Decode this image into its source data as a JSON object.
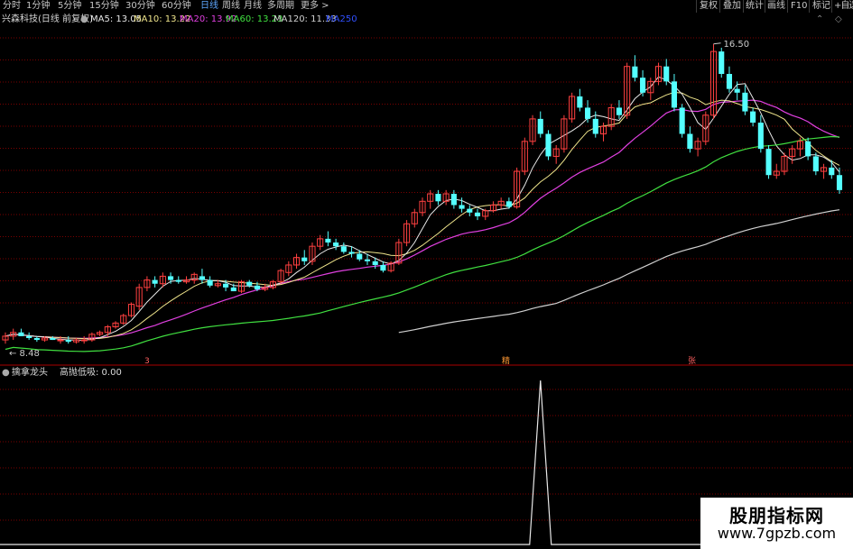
{
  "toolbar": {
    "periods": [
      "分时",
      "1分钟",
      "5分钟",
      "15分钟",
      "30分钟",
      "60分钟",
      "日线",
      "周线",
      "月线",
      "多周期",
      "更多 >"
    ],
    "active_period": "日线",
    "right_buttons": [
      "复权",
      "叠加",
      "统计",
      "画线",
      "F10",
      "标记",
      "+自选"
    ]
  },
  "info": {
    "title": "兴森科技(日线 前复权)",
    "ma": [
      {
        "label": "MA5: 13.05",
        "color": "#e8e8e8"
      },
      {
        "label": "MA10: 13.22",
        "color": "#f0e68c"
      },
      {
        "label": "MA20: 13.92",
        "color": "#e040e0"
      },
      {
        "label": "MA60: 13.23",
        "color": "#40e040"
      },
      {
        "label": "MA120: 11.33",
        "color": "#d0d0d0"
      },
      {
        "label": "MA250",
        "color": "#3050ff"
      }
    ]
  },
  "indicator": {
    "name": "擒拿龙头",
    "value_label": "高抛低吸: 0.00"
  },
  "annotations": {
    "high": "16.50",
    "low": "8.48",
    "marks": [
      "3",
      "精",
      "张"
    ]
  },
  "colors": {
    "up": "#ff4040",
    "down": "#54ffff",
    "grid": "#7a0000"
  },
  "watermark": {
    "line1": "股朋指标网",
    "line2": "www.7gpzb.com"
  },
  "chart_data": [
    {
      "type": "candlestick",
      "title": "兴森科技(日线 前复权)",
      "ylim": [
        8.0,
        17.0
      ],
      "candles": [
        [
          8.6,
          8.8,
          8.5,
          8.7
        ],
        [
          8.7,
          8.9,
          8.6,
          8.8
        ],
        [
          8.8,
          8.9,
          8.7,
          8.7
        ],
        [
          8.7,
          8.8,
          8.6,
          8.65
        ],
        [
          8.65,
          8.7,
          8.55,
          8.6
        ],
        [
          8.6,
          8.7,
          8.55,
          8.65
        ],
        [
          8.65,
          8.7,
          8.6,
          8.6
        ],
        [
          8.6,
          8.7,
          8.5,
          8.6
        ],
        [
          8.6,
          8.7,
          8.5,
          8.55
        ],
        [
          8.55,
          8.65,
          8.5,
          8.6
        ],
        [
          8.6,
          8.7,
          8.5,
          8.6
        ],
        [
          8.6,
          8.8,
          8.55,
          8.75
        ],
        [
          8.75,
          8.85,
          8.7,
          8.8
        ],
        [
          8.8,
          9.0,
          8.7,
          8.95
        ],
        [
          8.95,
          9.1,
          8.9,
          9.05
        ],
        [
          9.05,
          9.3,
          9.0,
          9.25
        ],
        [
          9.25,
          9.6,
          9.2,
          9.55
        ],
        [
          9.5,
          10.1,
          9.4,
          10.0
        ],
        [
          10.0,
          10.3,
          9.9,
          10.2
        ],
        [
          10.2,
          10.3,
          10.0,
          10.1
        ],
        [
          10.1,
          10.4,
          10.0,
          10.3
        ],
        [
          10.3,
          10.4,
          10.1,
          10.2
        ],
        [
          10.2,
          10.3,
          10.1,
          10.15
        ],
        [
          10.15,
          10.3,
          10.1,
          10.2
        ],
        [
          10.2,
          10.4,
          10.1,
          10.35
        ],
        [
          10.3,
          10.5,
          10.1,
          10.2
        ],
        [
          10.2,
          10.3,
          10.0,
          10.05
        ],
        [
          10.05,
          10.2,
          10.0,
          10.1
        ],
        [
          10.1,
          10.2,
          9.9,
          10.0
        ],
        [
          10.0,
          10.1,
          9.9,
          9.9
        ],
        [
          9.9,
          10.2,
          9.85,
          10.15
        ],
        [
          10.15,
          10.2,
          10.0,
          10.05
        ],
        [
          10.05,
          10.15,
          9.9,
          9.95
        ],
        [
          9.95,
          10.1,
          9.9,
          10.0
        ],
        [
          10.0,
          10.2,
          9.95,
          10.15
        ],
        [
          10.15,
          10.5,
          10.1,
          10.45
        ],
        [
          10.4,
          10.7,
          10.3,
          10.6
        ],
        [
          10.6,
          10.9,
          10.5,
          10.8
        ],
        [
          10.8,
          11.0,
          10.6,
          10.7
        ],
        [
          10.7,
          11.2,
          10.6,
          11.1
        ],
        [
          11.1,
          11.4,
          11.0,
          11.3
        ],
        [
          11.3,
          11.5,
          11.1,
          11.2
        ],
        [
          11.2,
          11.3,
          11.0,
          11.1
        ],
        [
          11.1,
          11.2,
          10.9,
          10.95
        ],
        [
          10.95,
          11.1,
          10.8,
          10.9
        ],
        [
          10.9,
          11.0,
          10.7,
          10.75
        ],
        [
          10.75,
          10.9,
          10.6,
          10.7
        ],
        [
          10.7,
          10.8,
          10.5,
          10.6
        ],
        [
          10.6,
          10.7,
          10.4,
          10.45
        ],
        [
          10.45,
          10.7,
          10.4,
          10.65
        ],
        [
          10.65,
          11.3,
          10.6,
          11.2
        ],
        [
          11.2,
          11.8,
          11.1,
          11.7
        ],
        [
          11.7,
          12.1,
          11.6,
          12.0
        ],
        [
          12.0,
          12.4,
          11.9,
          12.3
        ],
        [
          12.3,
          12.6,
          12.1,
          12.5
        ],
        [
          12.5,
          12.6,
          12.2,
          12.3
        ],
        [
          12.3,
          12.6,
          12.2,
          12.5
        ],
        [
          12.5,
          12.6,
          12.1,
          12.2
        ],
        [
          12.2,
          12.4,
          12.0,
          12.1
        ],
        [
          12.1,
          12.2,
          11.9,
          12.0
        ],
        [
          12.0,
          12.1,
          11.8,
          11.9
        ],
        [
          11.9,
          12.1,
          11.8,
          12.05
        ],
        [
          12.05,
          12.3,
          12.0,
          12.2
        ],
        [
          12.2,
          12.4,
          12.1,
          12.3
        ],
        [
          12.3,
          12.4,
          12.1,
          12.15
        ],
        [
          12.15,
          13.2,
          12.1,
          13.1
        ],
        [
          13.1,
          14.0,
          13.0,
          13.9
        ],
        [
          13.9,
          14.6,
          13.8,
          14.5
        ],
        [
          14.5,
          14.7,
          14.0,
          14.1
        ],
        [
          14.1,
          14.2,
          13.4,
          13.5
        ],
        [
          13.5,
          13.8,
          13.3,
          13.7
        ],
        [
          13.7,
          14.6,
          13.6,
          14.5
        ],
        [
          14.5,
          15.2,
          14.4,
          15.1
        ],
        [
          15.1,
          15.3,
          14.7,
          14.8
        ],
        [
          14.8,
          15.0,
          14.4,
          14.5
        ],
        [
          14.5,
          14.7,
          14.0,
          14.1
        ],
        [
          14.1,
          14.4,
          13.9,
          14.3
        ],
        [
          14.3,
          14.9,
          14.2,
          14.8
        ],
        [
          14.8,
          15.0,
          14.5,
          14.6
        ],
        [
          14.6,
          16.0,
          14.5,
          15.9
        ],
        [
          15.9,
          16.2,
          15.5,
          15.6
        ],
        [
          15.6,
          15.8,
          15.1,
          15.2
        ],
        [
          15.2,
          15.6,
          15.0,
          15.5
        ],
        [
          15.5,
          16.0,
          15.4,
          15.9
        ],
        [
          15.9,
          16.1,
          15.4,
          15.5
        ],
        [
          15.5,
          15.7,
          14.7,
          14.8
        ],
        [
          14.8,
          14.9,
          14.0,
          14.1
        ],
        [
          14.1,
          14.3,
          13.6,
          13.7
        ],
        [
          13.7,
          14.0,
          13.5,
          13.9
        ],
        [
          13.9,
          14.7,
          13.8,
          14.6
        ],
        [
          14.6,
          16.5,
          14.5,
          16.3
        ],
        [
          16.3,
          16.4,
          15.6,
          15.7
        ],
        [
          15.7,
          15.9,
          15.2,
          15.3
        ],
        [
          15.3,
          15.5,
          15.0,
          15.2
        ],
        [
          15.2,
          15.4,
          14.6,
          14.7
        ],
        [
          14.7,
          14.8,
          14.3,
          14.4
        ],
        [
          14.4,
          14.6,
          13.6,
          13.7
        ],
        [
          13.7,
          13.8,
          12.9,
          13.0
        ],
        [
          13.0,
          13.3,
          12.9,
          13.1
        ],
        [
          13.1,
          13.6,
          13.0,
          13.5
        ],
        [
          13.5,
          13.8,
          13.3,
          13.7
        ],
        [
          13.7,
          14.0,
          13.5,
          13.9
        ],
        [
          13.9,
          14.0,
          13.4,
          13.5
        ],
        [
          13.5,
          13.6,
          13.0,
          13.1
        ],
        [
          13.1,
          13.3,
          12.9,
          13.2
        ],
        [
          13.2,
          13.4,
          12.9,
          13.0
        ],
        [
          13.0,
          13.2,
          12.5,
          12.6
        ]
      ],
      "series": [
        {
          "name": "MA5"
        },
        {
          "name": "MA10"
        },
        {
          "name": "MA20"
        },
        {
          "name": "MA60"
        },
        {
          "name": "MA120"
        }
      ]
    },
    {
      "type": "line",
      "title": "擒拿龙头",
      "series": [
        {
          "name": "高抛低吸",
          "peak_index": 68,
          "value_last": 0.0
        }
      ]
    }
  ]
}
